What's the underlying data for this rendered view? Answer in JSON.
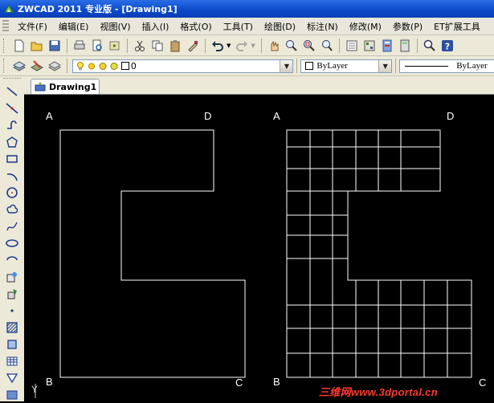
{
  "window": {
    "title": "ZWCAD 2011 专业版 - [Drawing1]"
  },
  "menu": {
    "items": [
      "文件(F)",
      "编辑(E)",
      "视图(V)",
      "插入(I)",
      "格式(O)",
      "工具(T)",
      "绘图(D)",
      "标注(N)",
      "修改(M)",
      "参数(P)",
      "ET扩展工具"
    ]
  },
  "layer_toolbar": {
    "layer_value": "0",
    "color_value": "ByLayer",
    "linetype_value": "ByLayer"
  },
  "tabs": {
    "active": "Drawing1"
  },
  "drawing": {
    "left_shape": {
      "labels": {
        "a": "A",
        "d": "D",
        "b": "B",
        "c": "C"
      }
    },
    "right_shape": {
      "labels": {
        "a": "A",
        "d": "D",
        "b": "B",
        "c": "C"
      }
    },
    "ucs_label": "Y"
  },
  "watermark": "三维网www.3dportal.cn",
  "colors": {
    "title_bar": "#0a48c8",
    "canvas": "#000000",
    "lines": "#ffffff",
    "watermark": "#ff3b2e"
  }
}
